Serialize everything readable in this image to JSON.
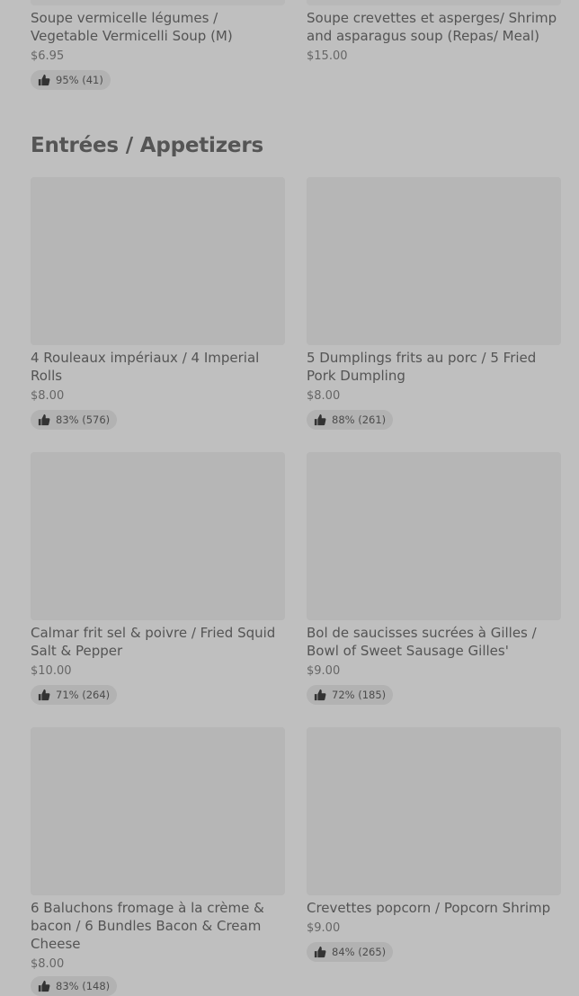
{
  "top_items": [
    {
      "name": "Soupe vermicelle légumes / Vegetable Vermicelli Soup (M)",
      "price": "$6.95",
      "rating": "95% (41)"
    },
    {
      "name": "Soupe crevettes et asperges/ Shrimp and asparagus soup (Repas/ Meal)",
      "price": "$15.00",
      "rating": ""
    }
  ],
  "section": {
    "title": "Entrées / Appetizers",
    "items": [
      {
        "name": "4 Rouleaux impériaux / 4 Imperial Rolls",
        "price": "$8.00",
        "rating": "83% (576)"
      },
      {
        "name": "5 Dumplings frits au porc / 5 Fried Pork Dumpling",
        "price": "$8.00",
        "rating": "88% (261)"
      },
      {
        "name": "Calmar frit sel & poivre / Fried Squid Salt & Pepper",
        "price": "$10.00",
        "rating": "71% (264)"
      },
      {
        "name": "Bol de saucisses sucrées à Gilles / Bowl of Sweet Sausage Gilles'",
        "price": "$9.00",
        "rating": "72% (185)"
      },
      {
        "name": "6 Baluchons fromage à la crème & bacon / 6 Bundles Bacon & Cream Cheese",
        "price": "$8.00",
        "rating": "83% (148)"
      },
      {
        "name": "Crevettes popcorn / Popcorn Shrimp",
        "price": "$9.00",
        "rating": "84% (265)"
      }
    ]
  },
  "icons": {
    "rating": "thumbs-up-icon"
  }
}
